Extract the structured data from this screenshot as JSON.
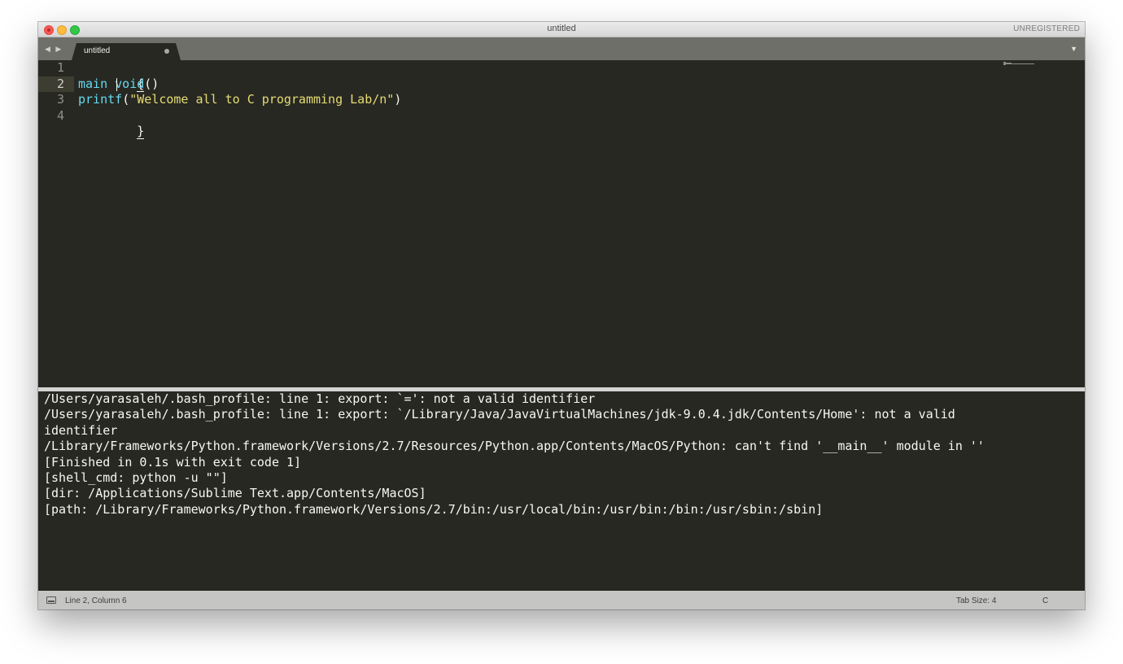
{
  "window": {
    "title": "untitled",
    "registration": "UNREGISTERED"
  },
  "tabs": {
    "nav_label": "◀ ▶",
    "menu_label": "▼",
    "items": [
      {
        "label": "untitled",
        "modified": true
      }
    ]
  },
  "editor": {
    "current_line": 2,
    "lines": [
      {
        "number": "1",
        "text": "{"
      },
      {
        "number": "2",
        "text": "main void()"
      },
      {
        "number": "3",
        "text": "printf(\"Welcome all to C programming Lab/n\")"
      },
      {
        "number": "4",
        "text": "}"
      }
    ],
    "tokens": {
      "line1": "{",
      "line2_fn": "main void",
      "line2_parens": "()",
      "line3_fn": "printf",
      "line3_open": "(",
      "line3_str": "\"Welcome all to C programming Lab/n\"",
      "line3_close": ")",
      "line4": "}"
    }
  },
  "output": {
    "lines": [
      "/Users/yarasaleh/.bash_profile: line 1: export: `=': not a valid identifier",
      "/Users/yarasaleh/.bash_profile: line 1: export: `/Library/Java/JavaVirtualMachines/jdk-9.0.4.jdk/Contents/Home': not a valid",
      "identifier",
      "/Library/Frameworks/Python.framework/Versions/2.7/Resources/Python.app/Contents/MacOS/Python: can't find '__main__' module in ''",
      "[Finished in 0.1s with exit code 1]",
      "[shell_cmd: python -u \"\"]",
      "[dir: /Applications/Sublime Text.app/Contents/MacOS]",
      "[path: /Library/Frameworks/Python.framework/Versions/2.7/bin:/usr/local/bin:/usr/bin:/bin:/usr/sbin:/sbin]"
    ]
  },
  "status": {
    "position": "Line 2, Column 6",
    "tab_size": "Tab Size: 4",
    "syntax": "C"
  },
  "colors": {
    "background": "#272822",
    "function": "#66d9ef",
    "string": "#e6db74",
    "text": "#f8f8f2"
  }
}
